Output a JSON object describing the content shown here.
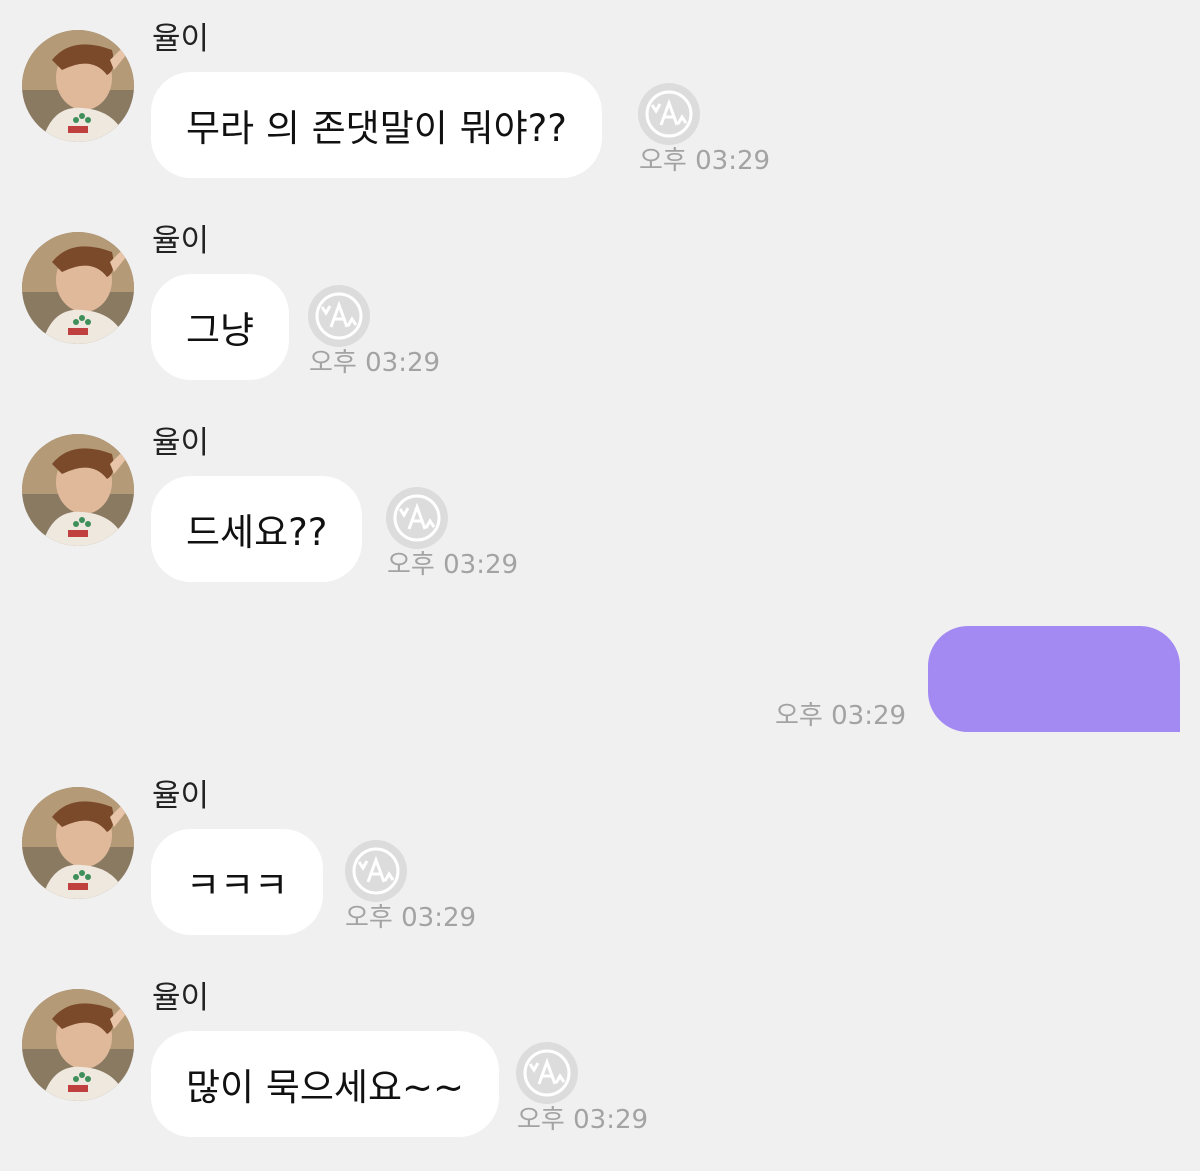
{
  "chat": {
    "incoming": [
      {
        "sender": "율이",
        "text": "무라 의 존댓말이 뭐야??",
        "time": "오후 03:29"
      },
      {
        "sender": "율이",
        "text": "그냥",
        "time": "오후 03:29"
      },
      {
        "sender": "율이",
        "text": "드세요??",
        "time": "오후 03:29"
      },
      {
        "sender": "율이",
        "text": "ㅋㅋㅋ",
        "time": "오후 03:29"
      },
      {
        "sender": "율이",
        "text": "많이 묵으세요~~",
        "time": "오후 03:29"
      }
    ],
    "outgoing": [
      {
        "text": "",
        "time": "오후 03:29"
      }
    ]
  },
  "colors": {
    "background": "#f0f0f0",
    "incoming_bubble": "#ffffff",
    "outgoing_bubble": "#a38af2",
    "timestamp": "#a3a3a3",
    "translate_button": "#dcdcdc"
  },
  "icons": {
    "avatar": "profile-photo",
    "translate": "translate-icon"
  }
}
